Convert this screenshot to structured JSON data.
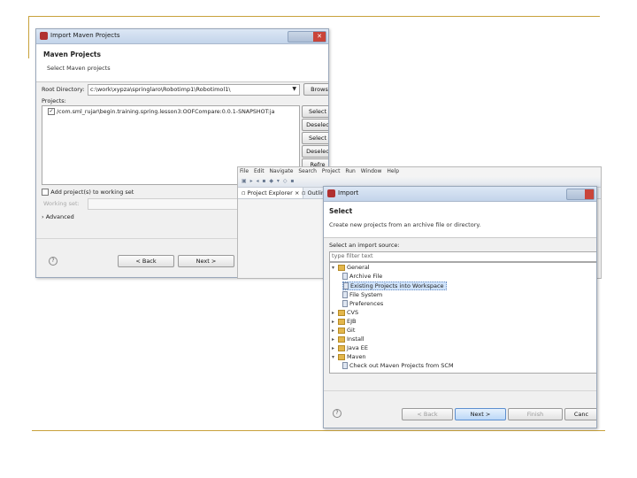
{
  "colors": {
    "accent_line": "#c8a23c",
    "selection": "#cfe3fb",
    "window_frame": "#9aa8bb"
  },
  "maven_dialog": {
    "title": "Import Maven Projects",
    "header_title": "Maven Projects",
    "header_subtitle": "Select Maven projects",
    "root_directory_label": "Root Directory:",
    "root_directory_value": "c:\\work\\xypza\\springlaro\\Robotimp1\\Robotimol1\\",
    "browse_button": "Brows",
    "projects_label": "Projects:",
    "project_items": [
      "/com.sml_rujar\\begin.training.spring.lesson3:OOFCompare:0.0.1-SNAPSHOT:ja"
    ],
    "side_buttons": [
      "Select",
      "Deselec",
      "Select",
      "Deselec",
      "Refre"
    ],
    "add_to_working_set_label": "Add project(s) to working set",
    "working_set_label": "Working set:",
    "advanced_label": "Advanced",
    "help_icon": "question-icon",
    "back_button": "< Back",
    "next_button": "Next >"
  },
  "eclipse": {
    "menu": [
      "File",
      "Edit",
      "Navigate",
      "Search",
      "Project",
      "Run",
      "Window",
      "Help"
    ],
    "tabs": [
      "Project Explorer",
      "Outline"
    ]
  },
  "import_dialog": {
    "title": "Import",
    "header_title": "Select",
    "header_subtitle": "Create new projects from an archive file or directory.",
    "source_label": "Select an import source:",
    "filter_placeholder": "type filter text",
    "tree": [
      {
        "label": "General",
        "level": 0,
        "kind": "folder",
        "expanded": true
      },
      {
        "label": "Archive File",
        "level": 1,
        "kind": "file"
      },
      {
        "label": "Existing Projects into Workspace",
        "level": 1,
        "kind": "file",
        "selected": true
      },
      {
        "label": "File System",
        "level": 1,
        "kind": "file"
      },
      {
        "label": "Preferences",
        "level": 1,
        "kind": "file"
      },
      {
        "label": "CVS",
        "level": 0,
        "kind": "folder"
      },
      {
        "label": "EJB",
        "level": 0,
        "kind": "folder"
      },
      {
        "label": "Git",
        "level": 0,
        "kind": "folder"
      },
      {
        "label": "Install",
        "level": 0,
        "kind": "folder"
      },
      {
        "label": "Java EE",
        "level": 0,
        "kind": "folder"
      },
      {
        "label": "Maven",
        "level": 0,
        "kind": "folder",
        "expanded": true
      },
      {
        "label": "Check out Maven Projects from SCM",
        "level": 1,
        "kind": "file"
      }
    ],
    "help_icon": "question-icon",
    "back_button": "< Back",
    "next_button": "Next >",
    "finish_button": "Finish",
    "cancel_button": "Canc"
  }
}
